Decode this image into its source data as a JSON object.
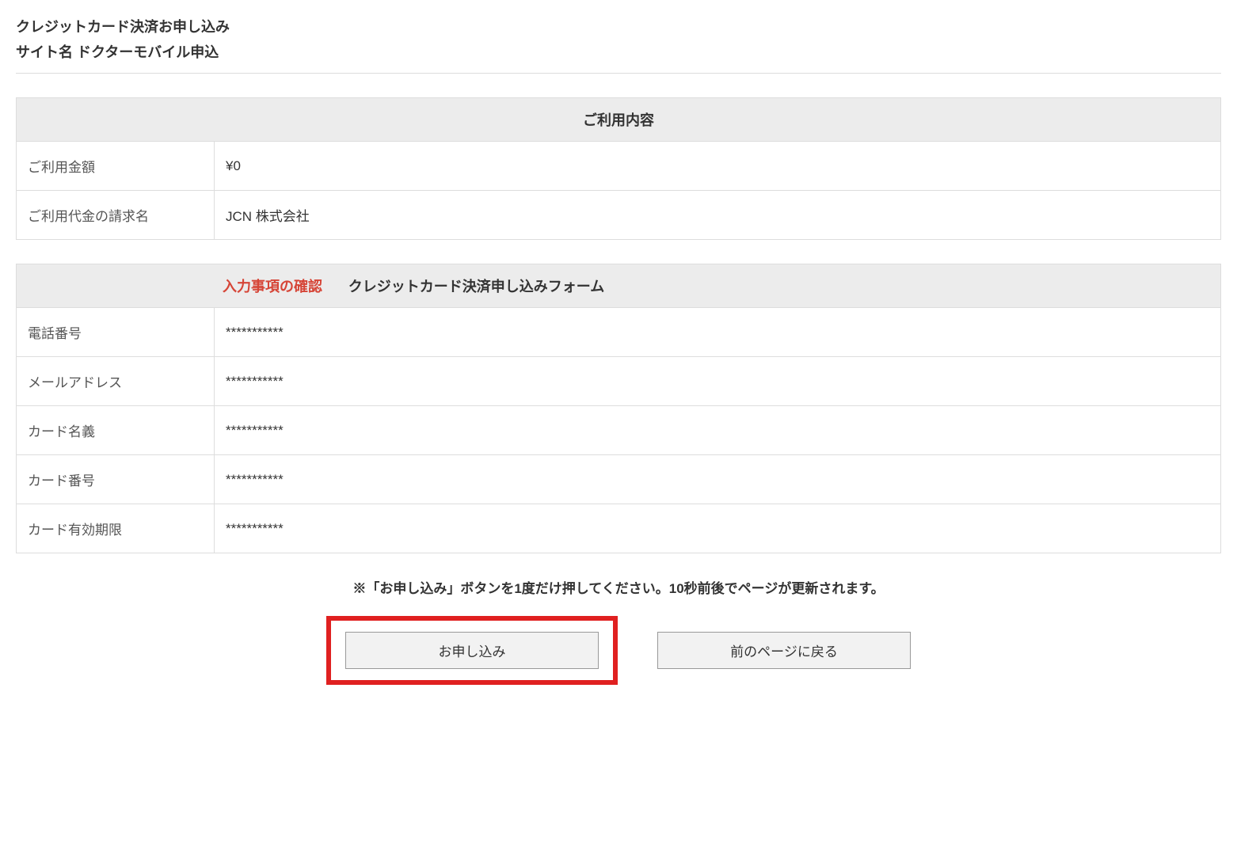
{
  "header": {
    "page_title": "クレジットカード決済お申し込み",
    "site_label": "サイト名",
    "site_name": "ドクターモバイル申込"
  },
  "usage_table": {
    "header": "ご利用内容",
    "rows": [
      {
        "label": "ご利用金額",
        "value": "¥0"
      },
      {
        "label": "ご利用代金の請求名",
        "value": "JCN 株式会社"
      }
    ]
  },
  "form_table": {
    "header_red": "入力事項の確認",
    "header_black": "クレジットカード決済申し込みフォーム",
    "rows": [
      {
        "label": "電話番号",
        "value": "***********"
      },
      {
        "label": "メールアドレス",
        "value": "***********"
      },
      {
        "label": "カード名義",
        "value": "***********"
      },
      {
        "label": "カード番号",
        "value": "***********"
      },
      {
        "label": "カード有効期限",
        "value": "***********"
      }
    ]
  },
  "notice": "※「お申し込み」ボタンを1度だけ押してください。10秒前後でページが更新されます。",
  "buttons": {
    "submit": "お申し込み",
    "back": "前のページに戻る"
  }
}
